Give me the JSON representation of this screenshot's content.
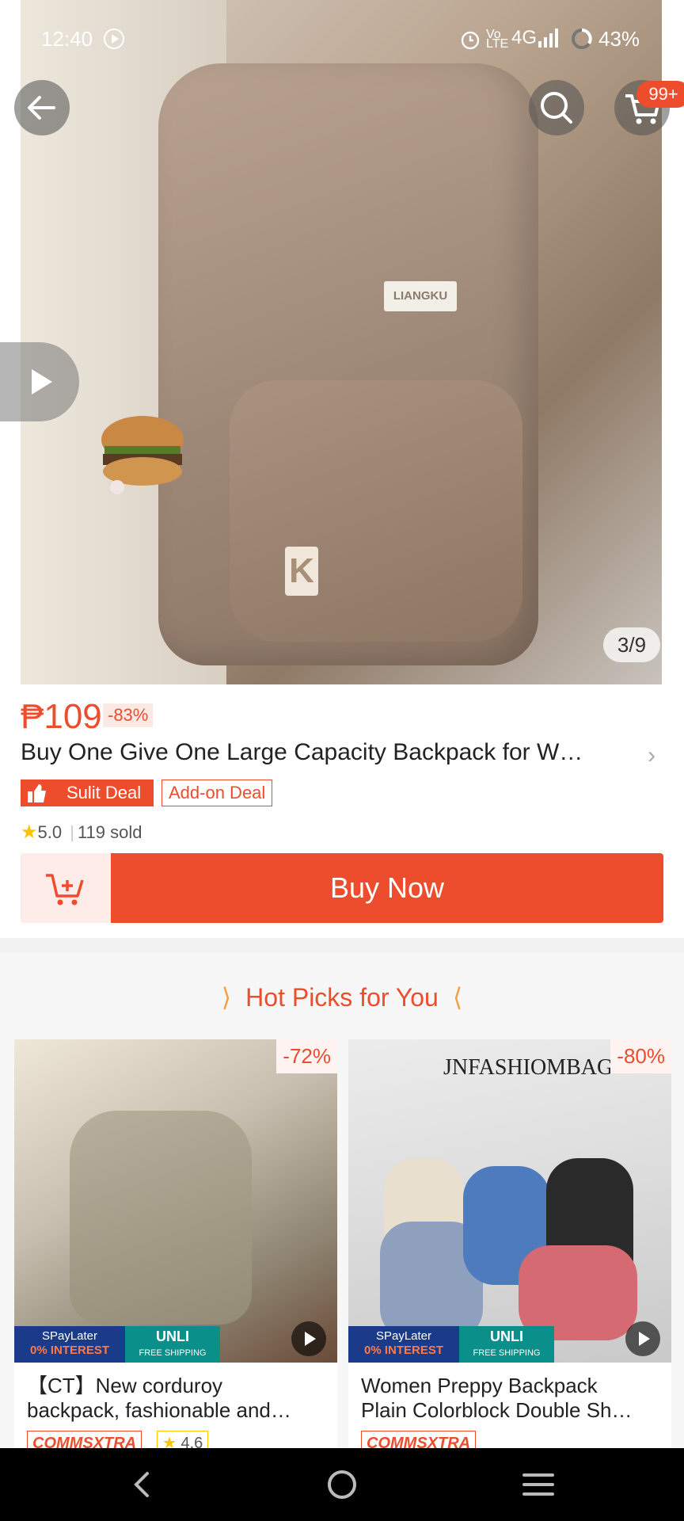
{
  "status": {
    "time": "12:40",
    "network": "4G",
    "battery": "43%"
  },
  "header": {
    "cart_badge": "99+"
  },
  "hero": {
    "brand_patch": "LIANGKU",
    "letter_patch": "K",
    "counter": "3/9"
  },
  "product": {
    "price": "₱109",
    "discount": "-83%",
    "title": "Buy One Give One Large Capacity Backpack for W…",
    "tag_deal": "Sulit Deal",
    "tag_addon": "Add-on Deal",
    "rating": "5.0",
    "sold": "119 sold",
    "buy_now": "Buy Now"
  },
  "hot_picks": {
    "title": "Hot Picks for You",
    "items": [
      {
        "discount": "-72%",
        "title_line1": "【CT】New corduroy",
        "title_line2": "backpack, fashionable and…",
        "promo_left_top": "SPayLater",
        "promo_left_bottom": "0% INTEREST",
        "promo_right_top": "UNLI",
        "promo_right_bottom": "FREE SHIPPING",
        "tag": "COMMSXTRA",
        "rating": "4.6"
      },
      {
        "discount": "-80%",
        "watermark": "JNFASHIOMBAG",
        "title_line1": "Women Preppy Backpack",
        "title_line2": "Plain Colorblock Double Sh…",
        "promo_left_top": "SPayLater",
        "promo_left_bottom": "0% INTEREST",
        "promo_right_top": "UNLI",
        "promo_right_bottom": "FREE SHIPPING",
        "tag": "COMMSXTRA"
      }
    ]
  },
  "colors": {
    "accent": "#ee4d2d",
    "nav_bg": "#000000"
  }
}
